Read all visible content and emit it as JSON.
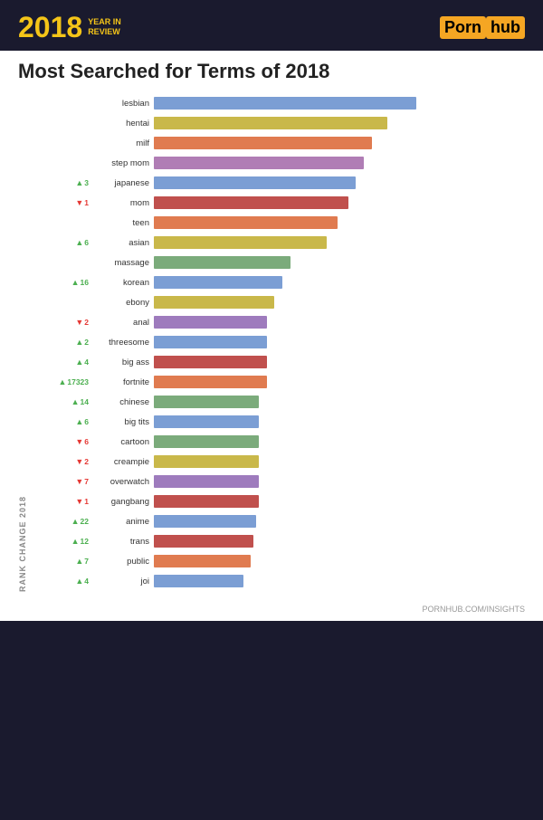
{
  "header": {
    "year": "2018",
    "year_sub": [
      "YEAR IN",
      "REVIEW"
    ],
    "brand_pre": "Porn",
    "brand_box": "hub"
  },
  "title": "Most Searched for Terms of 2018",
  "chart": {
    "rank_axis_label": "RANK CHANGE 2018",
    "bars": [
      {
        "term": "lesbian",
        "change": null,
        "dir": "none",
        "value": 100,
        "color": "#7b9ed4"
      },
      {
        "term": "hentai",
        "change": null,
        "dir": "none",
        "value": 89,
        "color": "#c9b84a"
      },
      {
        "term": "milf",
        "change": null,
        "dir": "none",
        "value": 83,
        "color": "#e07b50"
      },
      {
        "term": "step mom",
        "change": null,
        "dir": "none",
        "value": 80,
        "color": "#b07db5"
      },
      {
        "term": "japanese",
        "change": 3,
        "dir": "up",
        "value": 77,
        "color": "#7b9ed4"
      },
      {
        "term": "mom",
        "change": 1,
        "dir": "down",
        "value": 74,
        "color": "#c0504d"
      },
      {
        "term": "teen",
        "change": null,
        "dir": "none",
        "value": 70,
        "color": "#e07b50"
      },
      {
        "term": "asian",
        "change": 6,
        "dir": "up",
        "value": 66,
        "color": "#c9b84a"
      },
      {
        "term": "massage",
        "change": null,
        "dir": "none",
        "value": 52,
        "color": "#7bab7b"
      },
      {
        "term": "korean",
        "change": 16,
        "dir": "up",
        "value": 49,
        "color": "#7b9ed4"
      },
      {
        "term": "ebony",
        "change": null,
        "dir": "none",
        "value": 46,
        "color": "#c9b84a"
      },
      {
        "term": "anal",
        "change": 2,
        "dir": "down",
        "value": 43,
        "color": "#9e7bbd"
      },
      {
        "term": "threesome",
        "change": 2,
        "dir": "up",
        "value": 43,
        "color": "#7b9ed4"
      },
      {
        "term": "big ass",
        "change": 4,
        "dir": "up",
        "value": 43,
        "color": "#c0504d"
      },
      {
        "term": "fortnite",
        "change": 17323,
        "dir": "up",
        "value": 43,
        "color": "#e07b50"
      },
      {
        "term": "chinese",
        "change": 14,
        "dir": "up",
        "value": 40,
        "color": "#7bab7b"
      },
      {
        "term": "big tits",
        "change": 6,
        "dir": "up",
        "value": 40,
        "color": "#7b9ed4"
      },
      {
        "term": "cartoon",
        "change": 6,
        "dir": "down",
        "value": 40,
        "color": "#7bab7b"
      },
      {
        "term": "creampie",
        "change": 2,
        "dir": "down",
        "value": 40,
        "color": "#c9b84a"
      },
      {
        "term": "overwatch",
        "change": 7,
        "dir": "down",
        "value": 40,
        "color": "#9e7bbd"
      },
      {
        "term": "gangbang",
        "change": 1,
        "dir": "down",
        "value": 40,
        "color": "#c0504d"
      },
      {
        "term": "anime",
        "change": 22,
        "dir": "up",
        "value": 39,
        "color": "#7b9ed4"
      },
      {
        "term": "trans",
        "change": 12,
        "dir": "up",
        "value": 38,
        "color": "#c0504d"
      },
      {
        "term": "public",
        "change": 7,
        "dir": "up",
        "value": 37,
        "color": "#e07b50"
      },
      {
        "term": "joi",
        "change": 4,
        "dir": "up",
        "value": 34,
        "color": "#7b9ed4"
      }
    ]
  },
  "footer_url": "PORNHUB.COM/INSIGHTS"
}
